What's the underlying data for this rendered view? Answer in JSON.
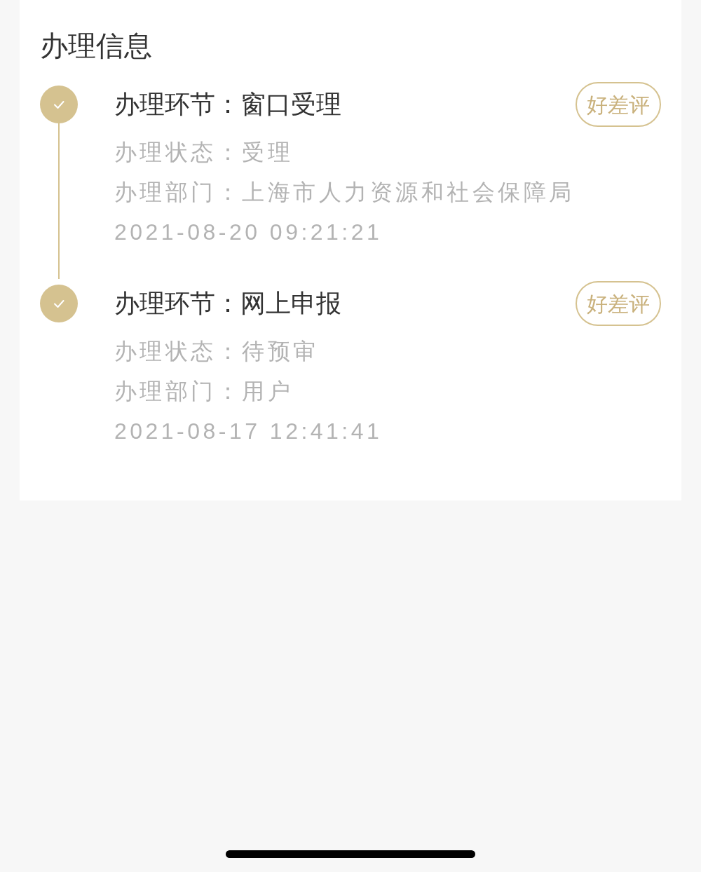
{
  "section_title": "办理信息",
  "steps": [
    {
      "title": "办理环节：窗口受理",
      "status": "办理状态：受理",
      "department": "办理部门：上海市人力资源和社会保障局",
      "time": "2021-08-20 09:21:21",
      "rate_button": "好差评",
      "done": true
    },
    {
      "title": "办理环节：网上申报",
      "status": "办理状态：待预审",
      "department": "办理部门：用户",
      "time": "2021-08-17 12:41:41",
      "rate_button": "好差评",
      "done": true
    }
  ]
}
